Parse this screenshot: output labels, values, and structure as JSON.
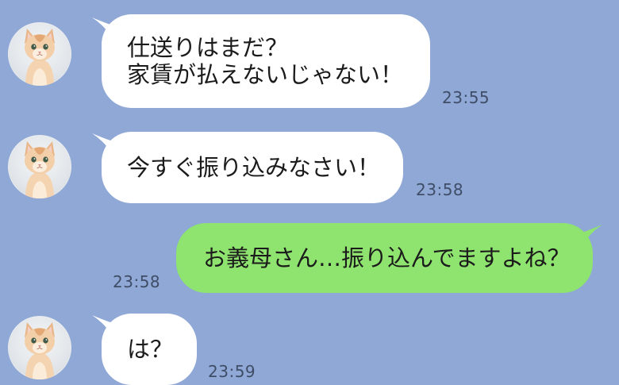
{
  "colors": {
    "background": "#8fa8d6",
    "received_bubble": "#ffffff",
    "sent_bubble": "#8fe36f",
    "timestamp": "#3f4d66"
  },
  "contact": {
    "avatar_icon": "cat-avatar-icon"
  },
  "messages": [
    {
      "direction": "received",
      "text": "仕送りはまだ？\n家賃が払えないじゃない！",
      "time": "23:55"
    },
    {
      "direction": "received",
      "text": "今すぐ振り込みなさい！",
      "time": "23:58"
    },
    {
      "direction": "sent",
      "text": "お義母さん…振り込んでますよね？",
      "time": "23:58"
    },
    {
      "direction": "received",
      "text": "は？",
      "time": "23:59"
    }
  ]
}
